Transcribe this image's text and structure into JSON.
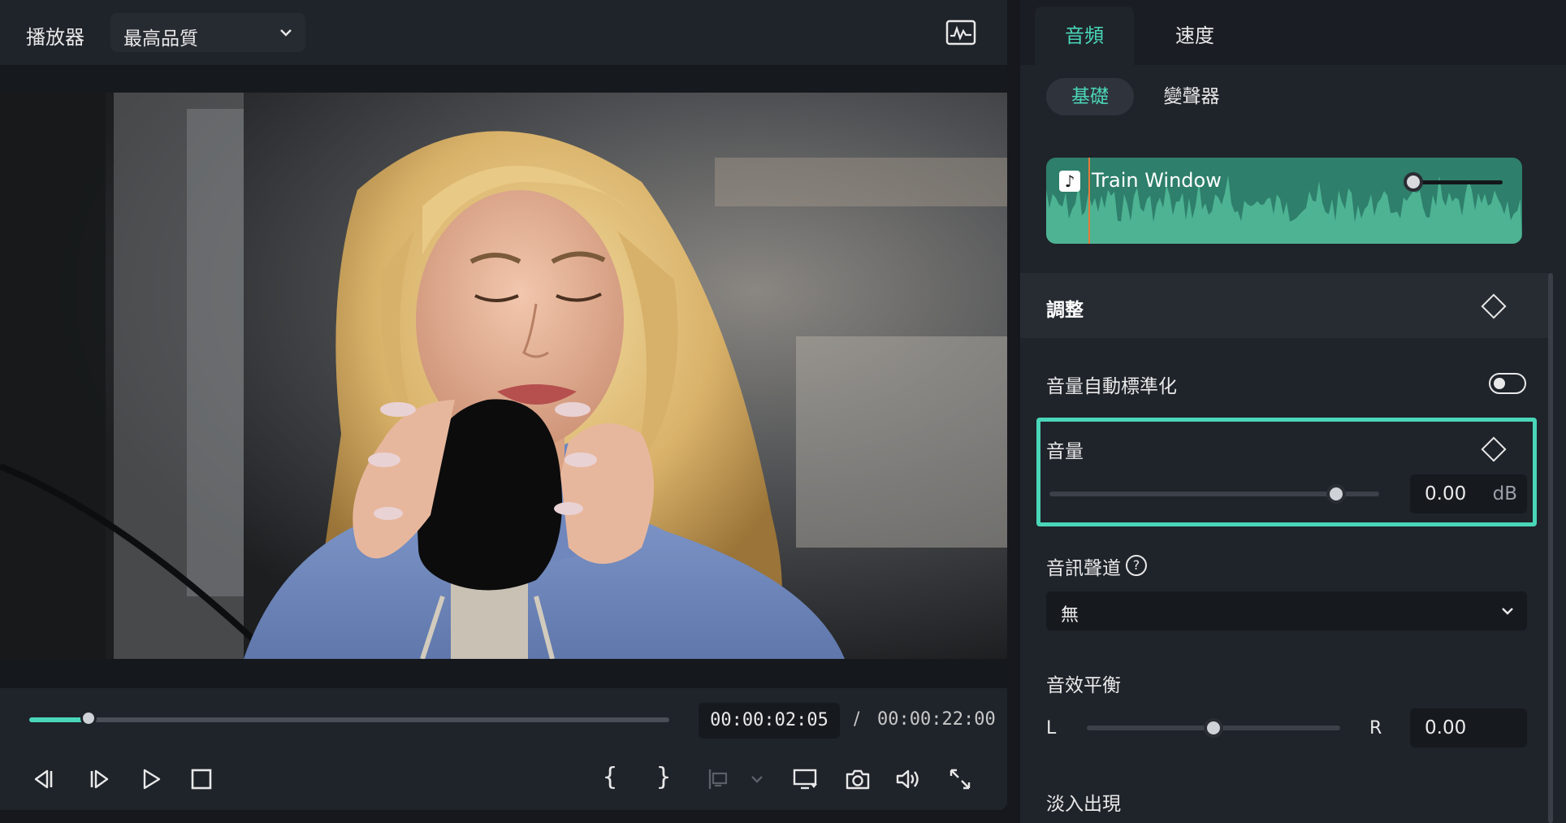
{
  "player": {
    "title": "播放器",
    "quality": "最高品質",
    "current_time": "00:00:02:05",
    "separator": "/",
    "total_time": "00:00:22:00",
    "progress": 0.093,
    "mark_in": "{",
    "mark_out": "}"
  },
  "panel": {
    "tabs": [
      {
        "label": "音頻",
        "active": true
      },
      {
        "label": "速度",
        "active": false
      }
    ],
    "subtabs": [
      {
        "label": "基礎",
        "active": true
      },
      {
        "label": "變聲器",
        "active": false
      }
    ],
    "clip": {
      "title": "Train Window",
      "note_glyph": "♪",
      "playhead": 0.07
    },
    "adjust": {
      "title": "調整"
    },
    "auto_normalize": {
      "label": "音量自動標準化",
      "enabled": false
    },
    "volume": {
      "label": "音量",
      "value": "0.00",
      "unit": "dB",
      "level": 0.87
    },
    "channel": {
      "label": "音訊聲道",
      "help_glyph": "?",
      "selected": "無"
    },
    "balance": {
      "label": "音效平衡",
      "left": "L",
      "right": "R",
      "value": "0.00",
      "level": 0.5
    },
    "fade": {
      "label": "淡入出現"
    }
  },
  "colors": {
    "accent": "#4ad6b8",
    "background": "#1f232a",
    "clip": "#2e7f6b",
    "playhead": "#e37b3a"
  }
}
